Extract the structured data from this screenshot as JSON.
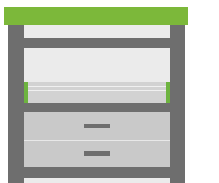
{
  "colors": {
    "accent_bar": "#7cb83a",
    "frame": "#6e6e6e",
    "back_panel": "#ebebeb",
    "drawer": "#c9c9c9",
    "cabinet": "#d2d2d2",
    "cabinet_edge": "#6db33f"
  },
  "icons": [
    "bolt-icon",
    "drawer-handle-icon"
  ]
}
